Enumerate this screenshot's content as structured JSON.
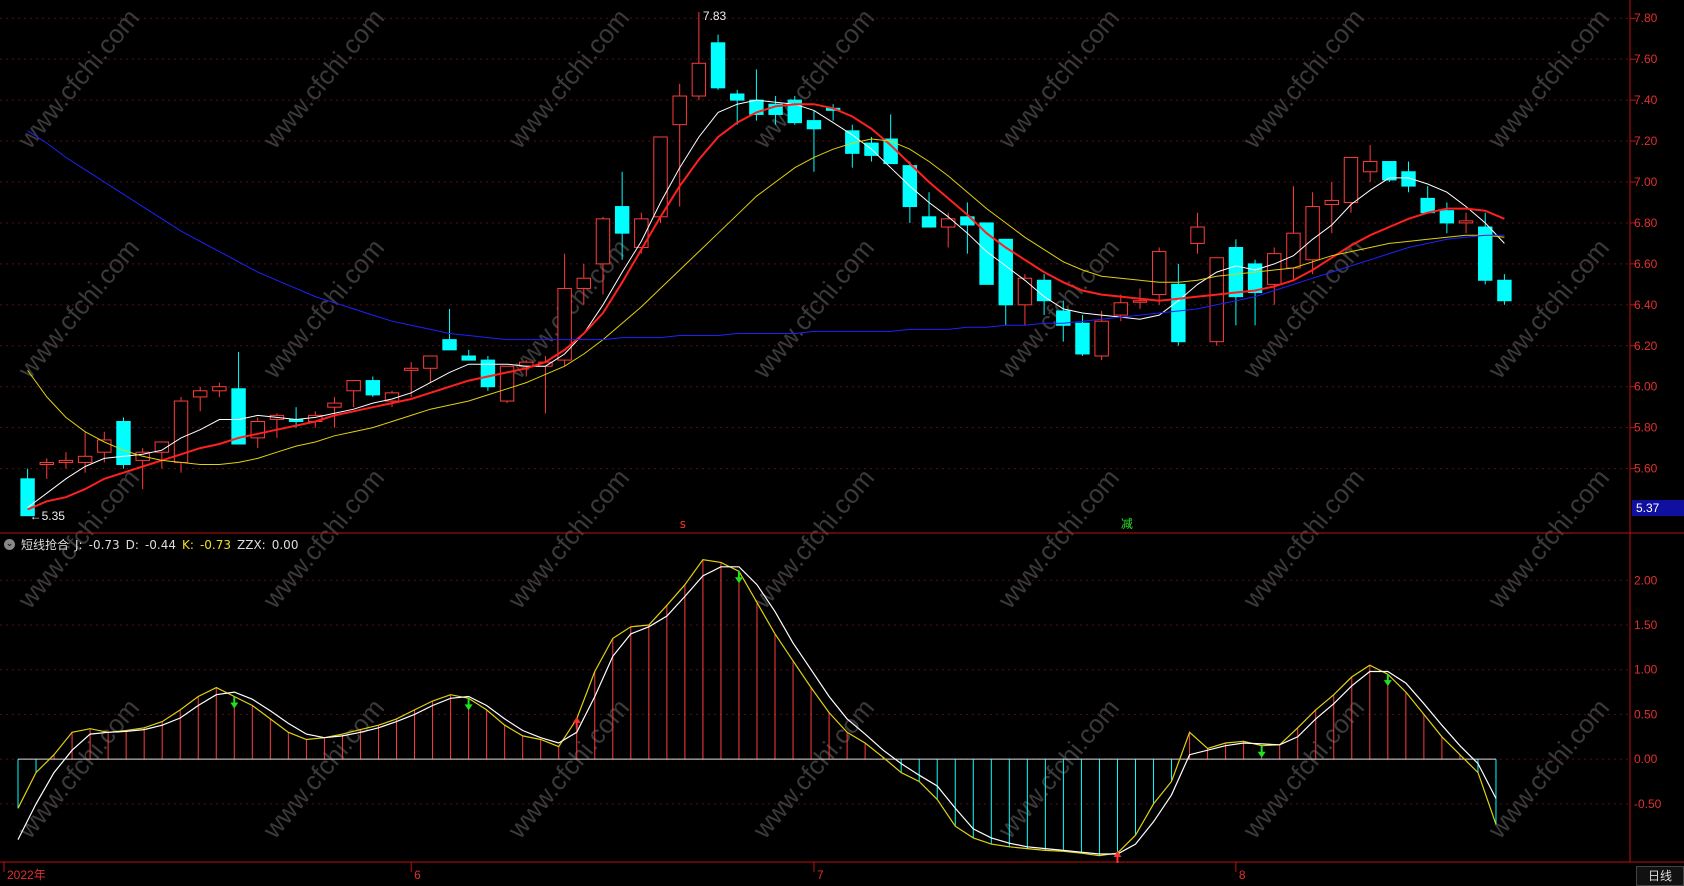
{
  "indicator": {
    "name": "短线抢合",
    "J_label": "J:",
    "J_value": "-0.73",
    "D_label": "D:",
    "D_value": "-0.44",
    "K_label": "K:",
    "K_value": "-0.73",
    "ZZX_label": "ZZX:",
    "ZZX_value": "0.00"
  },
  "timeframe_label": "日线",
  "price_axis": {
    "ticks": [
      "7.80",
      "7.60",
      "7.40",
      "7.20",
      "7.00",
      "6.80",
      "6.60",
      "6.40",
      "6.20",
      "6.00",
      "5.80",
      "5.60"
    ],
    "current_price": "5.37"
  },
  "indicator_axis": {
    "ticks": [
      "2.00",
      "1.50",
      "1.00",
      "0.50",
      "0.00",
      "-0.50"
    ]
  },
  "time_axis": {
    "labels": [
      "2022年",
      "6",
      "7",
      "8"
    ]
  },
  "markers": {
    "high_label": "7.83",
    "low_label": "5.35",
    "sell_glyph": "s",
    "reduce_glyph": "减"
  },
  "watermark": "www.cfchi.com",
  "colors": {
    "up": "#ff3b3b",
    "down": "#00ffff",
    "ma5": "#ffffff",
    "ma10": "#ff2020",
    "ma20": "#e0d010",
    "ma60": "#2020ff",
    "axis": "#c01010",
    "grid": "#551010"
  },
  "chart_data": [
    {
      "type": "candlestick",
      "title": "",
      "ylim": [
        5.3,
        7.85
      ],
      "grid": true,
      "candles": [
        {
          "o": 5.55,
          "h": 5.6,
          "l": 5.37,
          "c": 5.37
        },
        {
          "o": 5.62,
          "h": 5.65,
          "l": 5.55,
          "c": 5.63
        },
        {
          "o": 5.63,
          "h": 5.68,
          "l": 5.6,
          "c": 5.64
        },
        {
          "o": 5.63,
          "h": 5.78,
          "l": 5.58,
          "c": 5.66
        },
        {
          "o": 5.68,
          "h": 5.78,
          "l": 5.63,
          "c": 5.74
        },
        {
          "o": 5.83,
          "h": 5.85,
          "l": 5.6,
          "c": 5.62
        },
        {
          "o": 5.64,
          "h": 5.7,
          "l": 5.5,
          "c": 5.68
        },
        {
          "o": 5.68,
          "h": 5.73,
          "l": 5.6,
          "c": 5.73
        },
        {
          "o": 5.63,
          "h": 5.95,
          "l": 5.58,
          "c": 5.93
        },
        {
          "o": 5.95,
          "h": 6.0,
          "l": 5.88,
          "c": 5.98
        },
        {
          "o": 5.98,
          "h": 6.02,
          "l": 5.95,
          "c": 6.0
        },
        {
          "o": 5.99,
          "h": 6.17,
          "l": 5.72,
          "c": 5.72
        },
        {
          "o": 5.75,
          "h": 5.85,
          "l": 5.7,
          "c": 5.83
        },
        {
          "o": 5.84,
          "h": 5.87,
          "l": 5.75,
          "c": 5.86
        },
        {
          "o": 5.84,
          "h": 5.9,
          "l": 5.8,
          "c": 5.83
        },
        {
          "o": 5.83,
          "h": 5.88,
          "l": 5.8,
          "c": 5.86
        },
        {
          "o": 5.9,
          "h": 5.95,
          "l": 5.8,
          "c": 5.92
        },
        {
          "o": 5.98,
          "h": 6.03,
          "l": 5.9,
          "c": 6.03
        },
        {
          "o": 6.03,
          "h": 6.05,
          "l": 5.95,
          "c": 5.96
        },
        {
          "o": 5.93,
          "h": 5.98,
          "l": 5.9,
          "c": 5.97
        },
        {
          "o": 6.08,
          "h": 6.12,
          "l": 5.95,
          "c": 6.09
        },
        {
          "o": 6.09,
          "h": 6.15,
          "l": 6.02,
          "c": 6.15
        },
        {
          "o": 6.23,
          "h": 6.38,
          "l": 6.18,
          "c": 6.18
        },
        {
          "o": 6.15,
          "h": 6.18,
          "l": 6.13,
          "c": 6.13
        },
        {
          "o": 6.13,
          "h": 6.15,
          "l": 5.98,
          "c": 6.0
        },
        {
          "o": 5.93,
          "h": 6.1,
          "l": 5.92,
          "c": 6.1
        },
        {
          "o": 6.1,
          "h": 6.13,
          "l": 6.05,
          "c": 6.12
        },
        {
          "o": 6.1,
          "h": 6.15,
          "l": 5.87,
          "c": 6.12
        },
        {
          "o": 6.13,
          "h": 6.65,
          "l": 6.1,
          "c": 6.48
        },
        {
          "o": 6.48,
          "h": 6.6,
          "l": 6.4,
          "c": 6.53
        },
        {
          "o": 6.6,
          "h": 6.83,
          "l": 6.45,
          "c": 6.82
        },
        {
          "o": 6.88,
          "h": 7.05,
          "l": 6.62,
          "c": 6.75
        },
        {
          "o": 6.68,
          "h": 6.85,
          "l": 6.65,
          "c": 6.82
        },
        {
          "o": 6.83,
          "h": 7.2,
          "l": 6.8,
          "c": 7.22
        },
        {
          "o": 7.28,
          "h": 7.48,
          "l": 6.88,
          "c": 7.42
        },
        {
          "o": 7.42,
          "h": 7.83,
          "l": 7.4,
          "c": 7.58
        },
        {
          "o": 7.68,
          "h": 7.72,
          "l": 7.45,
          "c": 7.46
        },
        {
          "o": 7.43,
          "h": 7.45,
          "l": 7.28,
          "c": 7.4
        },
        {
          "o": 7.4,
          "h": 7.55,
          "l": 7.3,
          "c": 7.33
        },
        {
          "o": 7.38,
          "h": 7.42,
          "l": 7.28,
          "c": 7.33
        },
        {
          "o": 7.4,
          "h": 7.42,
          "l": 7.28,
          "c": 7.29
        },
        {
          "o": 7.3,
          "h": 7.35,
          "l": 7.05,
          "c": 7.26
        },
        {
          "o": 7.36,
          "h": 7.38,
          "l": 7.3,
          "c": 7.35
        },
        {
          "o": 7.25,
          "h": 7.28,
          "l": 7.07,
          "c": 7.14
        },
        {
          "o": 7.19,
          "h": 7.22,
          "l": 7.1,
          "c": 7.13
        },
        {
          "o": 7.21,
          "h": 7.33,
          "l": 7.09,
          "c": 7.09
        },
        {
          "o": 7.08,
          "h": 7.1,
          "l": 6.8,
          "c": 6.88
        },
        {
          "o": 6.83,
          "h": 6.95,
          "l": 6.78,
          "c": 6.78
        },
        {
          "o": 6.78,
          "h": 6.85,
          "l": 6.68,
          "c": 6.82
        },
        {
          "o": 6.83,
          "h": 6.9,
          "l": 6.65,
          "c": 6.79
        },
        {
          "o": 6.8,
          "h": 6.8,
          "l": 6.5,
          "c": 6.5
        },
        {
          "o": 6.72,
          "h": 6.72,
          "l": 6.3,
          "c": 6.4
        },
        {
          "o": 6.4,
          "h": 6.55,
          "l": 6.3,
          "c": 6.53
        },
        {
          "o": 6.52,
          "h": 6.55,
          "l": 6.35,
          "c": 6.42
        },
        {
          "o": 6.37,
          "h": 6.42,
          "l": 6.22,
          "c": 6.3
        },
        {
          "o": 6.31,
          "h": 6.35,
          "l": 6.15,
          "c": 6.16
        },
        {
          "o": 6.15,
          "h": 6.37,
          "l": 6.13,
          "c": 6.32
        },
        {
          "o": 6.35,
          "h": 6.45,
          "l": 6.32,
          "c": 6.41
        },
        {
          "o": 6.42,
          "h": 6.48,
          "l": 6.38,
          "c": 6.42
        },
        {
          "o": 6.45,
          "h": 6.68,
          "l": 6.4,
          "c": 6.66
        },
        {
          "o": 6.5,
          "h": 6.6,
          "l": 6.2,
          "c": 6.22
        },
        {
          "o": 6.7,
          "h": 6.85,
          "l": 6.65,
          "c": 6.78
        },
        {
          "o": 6.22,
          "h": 6.62,
          "l": 6.2,
          "c": 6.63
        },
        {
          "o": 6.68,
          "h": 6.72,
          "l": 6.3,
          "c": 6.44
        },
        {
          "o": 6.6,
          "h": 6.62,
          "l": 6.3,
          "c": 6.46
        },
        {
          "o": 6.5,
          "h": 6.68,
          "l": 6.4,
          "c": 6.65
        },
        {
          "o": 6.58,
          "h": 6.98,
          "l": 6.52,
          "c": 6.75
        },
        {
          "o": 6.62,
          "h": 6.95,
          "l": 6.55,
          "c": 6.88
        },
        {
          "o": 6.89,
          "h": 7.0,
          "l": 6.75,
          "c": 6.91
        },
        {
          "o": 6.9,
          "h": 7.1,
          "l": 6.85,
          "c": 7.12
        },
        {
          "o": 7.05,
          "h": 7.18,
          "l": 7.0,
          "c": 7.1
        },
        {
          "o": 7.1,
          "h": 7.05,
          "l": 7.0,
          "c": 7.01
        },
        {
          "o": 7.05,
          "h": 7.1,
          "l": 6.95,
          "c": 6.98
        },
        {
          "o": 6.92,
          "h": 6.98,
          "l": 6.85,
          "c": 6.85
        },
        {
          "o": 6.86,
          "h": 6.9,
          "l": 6.75,
          "c": 6.8
        },
        {
          "o": 6.8,
          "h": 6.85,
          "l": 6.75,
          "c": 6.81
        },
        {
          "o": 6.78,
          "h": 6.85,
          "l": 6.5,
          "c": 6.52
        },
        {
          "o": 6.52,
          "h": 6.55,
          "l": 6.4,
          "c": 6.42
        }
      ],
      "series": [
        {
          "name": "MA5",
          "values": [
            5.41,
            5.48,
            5.55,
            5.61,
            5.65,
            5.66,
            5.67,
            5.69,
            5.75,
            5.79,
            5.84,
            5.84,
            5.86,
            5.85,
            5.84,
            5.85,
            5.87,
            5.89,
            5.92,
            5.94,
            5.97,
            6.02,
            6.07,
            6.11,
            6.11,
            6.11,
            6.1,
            6.1,
            6.16,
            6.26,
            6.4,
            6.56,
            6.71,
            6.9,
            7.07,
            7.22,
            7.34,
            7.38,
            7.4,
            7.39,
            7.38,
            7.35,
            7.29,
            7.23,
            7.16,
            7.07,
            6.98,
            6.9,
            6.83,
            6.75,
            6.66,
            6.59,
            6.52,
            6.44,
            6.38,
            6.36,
            6.35,
            6.34,
            6.33,
            6.35,
            6.42,
            6.5,
            6.56,
            6.59,
            6.57,
            6.6,
            6.64,
            6.72,
            6.79,
            6.89,
            6.96,
            7.02,
            7.02,
            6.99,
            6.95,
            6.88,
            6.8,
            6.7
          ]
        },
        {
          "name": "MA10",
          "values": [
            5.4,
            5.44,
            5.46,
            5.5,
            5.55,
            5.58,
            5.61,
            5.64,
            5.67,
            5.7,
            5.72,
            5.75,
            5.77,
            5.79,
            5.81,
            5.83,
            5.86,
            5.88,
            5.9,
            5.92,
            5.94,
            5.97,
            6.0,
            6.03,
            6.05,
            6.07,
            6.09,
            6.12,
            6.18,
            6.26,
            6.36,
            6.51,
            6.67,
            6.83,
            6.98,
            7.11,
            7.22,
            7.29,
            7.34,
            7.37,
            7.38,
            7.38,
            7.36,
            7.32,
            7.26,
            7.18,
            7.09,
            7.0,
            6.92,
            6.84,
            6.75,
            6.68,
            6.62,
            6.56,
            6.51,
            6.47,
            6.45,
            6.44,
            6.43,
            6.42,
            6.43,
            6.44,
            6.45,
            6.46,
            6.47,
            6.49,
            6.52,
            6.57,
            6.63,
            6.69,
            6.74,
            6.78,
            6.82,
            6.85,
            6.87,
            6.87,
            6.86,
            6.82
          ]
        },
        {
          "name": "MA20",
          "values": [
            6.08,
            5.95,
            5.85,
            5.78,
            5.73,
            5.69,
            5.66,
            5.64,
            5.63,
            5.62,
            5.62,
            5.63,
            5.65,
            5.68,
            5.71,
            5.73,
            5.76,
            5.78,
            5.8,
            5.83,
            5.86,
            5.89,
            5.91,
            5.93,
            5.96,
            5.99,
            6.02,
            6.06,
            6.1,
            6.16,
            6.23,
            6.31,
            6.39,
            6.48,
            6.57,
            6.66,
            6.75,
            6.84,
            6.93,
            7.0,
            7.07,
            7.12,
            7.16,
            7.19,
            7.21,
            7.2,
            7.16,
            7.1,
            7.03,
            6.95,
            6.87,
            6.8,
            6.73,
            6.67,
            6.61,
            6.57,
            6.54,
            6.53,
            6.52,
            6.51,
            6.51,
            6.52,
            6.54,
            6.55,
            6.56,
            6.57,
            6.58,
            6.61,
            6.64,
            6.66,
            6.68,
            6.7,
            6.71,
            6.72,
            6.73,
            6.74,
            6.74,
            6.73
          ]
        },
        {
          "name": "MA60",
          "values": [
            7.25,
            7.19,
            7.12,
            7.06,
            7.0,
            6.94,
            6.88,
            6.82,
            6.76,
            6.71,
            6.66,
            6.61,
            6.56,
            6.52,
            6.48,
            6.44,
            6.41,
            6.38,
            6.35,
            6.32,
            6.3,
            6.28,
            6.26,
            6.25,
            6.24,
            6.23,
            6.23,
            6.23,
            6.23,
            6.23,
            6.23,
            6.24,
            6.24,
            6.24,
            6.25,
            6.25,
            6.25,
            6.26,
            6.26,
            6.26,
            6.26,
            6.27,
            6.27,
            6.27,
            6.27,
            6.27,
            6.28,
            6.28,
            6.28,
            6.29,
            6.29,
            6.3,
            6.3,
            6.31,
            6.31,
            6.32,
            6.33,
            6.34,
            6.35,
            6.36,
            6.37,
            6.38,
            6.4,
            6.42,
            6.44,
            6.47,
            6.5,
            6.53,
            6.56,
            6.59,
            6.62,
            6.65,
            6.68,
            6.7,
            6.72,
            6.73,
            6.74,
            6.74
          ]
        }
      ]
    },
    {
      "type": "bar",
      "title": "短线抢合",
      "ylim": [
        -1.15,
        2.45
      ],
      "grid": true,
      "values": [
        -0.55,
        -0.15,
        0.05,
        0.3,
        0.34,
        0.3,
        0.32,
        0.35,
        0.42,
        0.55,
        0.7,
        0.8,
        0.7,
        0.6,
        0.45,
        0.3,
        0.22,
        0.24,
        0.28,
        0.33,
        0.38,
        0.45,
        0.55,
        0.65,
        0.72,
        0.68,
        0.55,
        0.38,
        0.26,
        0.22,
        0.14,
        0.45,
        0.98,
        1.35,
        1.48,
        1.5,
        1.72,
        1.95,
        2.23,
        2.2,
        2.1,
        1.75,
        1.4,
        1.1,
        0.8,
        0.52,
        0.3,
        0.18,
        0.02,
        -0.15,
        -0.25,
        -0.45,
        -0.75,
        -0.88,
        -0.95,
        -0.98,
        -1.0,
        -1.02,
        -1.03,
        -1.05,
        -1.08,
        -1.05,
        -0.85,
        -0.5,
        -0.25,
        0.3,
        0.12,
        0.18,
        0.2,
        0.15,
        0.16,
        0.35,
        0.55,
        0.72,
        0.92,
        1.05,
        0.95,
        0.75,
        0.5,
        0.25,
        0.05,
        -0.15,
        -0.73
      ],
      "J": [
        -0.55,
        -0.15,
        0.05,
        0.3,
        0.34,
        0.3,
        0.32,
        0.35,
        0.42,
        0.55,
        0.7,
        0.8,
        0.7,
        0.6,
        0.45,
        0.3,
        0.22,
        0.24,
        0.28,
        0.33,
        0.38,
        0.45,
        0.55,
        0.65,
        0.72,
        0.68,
        0.55,
        0.38,
        0.26,
        0.22,
        0.14,
        0.45,
        0.98,
        1.35,
        1.48,
        1.5,
        1.72,
        1.95,
        2.23,
        2.2,
        2.1,
        1.75,
        1.4,
        1.1,
        0.8,
        0.52,
        0.3,
        0.18,
        0.02,
        -0.15,
        -0.25,
        -0.45,
        -0.75,
        -0.88,
        -0.95,
        -0.98,
        -1.0,
        -1.02,
        -1.03,
        -1.05,
        -1.08,
        -1.05,
        -0.85,
        -0.5,
        -0.25,
        0.3,
        0.12,
        0.18,
        0.2,
        0.15,
        0.16,
        0.35,
        0.55,
        0.72,
        0.92,
        1.05,
        0.95,
        0.75,
        0.5,
        0.25,
        0.05,
        -0.15,
        -0.73
      ],
      "D": [
        -0.9,
        -0.5,
        -0.15,
        0.1,
        0.28,
        0.3,
        0.31,
        0.33,
        0.38,
        0.46,
        0.6,
        0.72,
        0.75,
        0.67,
        0.54,
        0.4,
        0.28,
        0.24,
        0.26,
        0.3,
        0.35,
        0.42,
        0.5,
        0.6,
        0.68,
        0.7,
        0.6,
        0.45,
        0.32,
        0.24,
        0.18,
        0.3,
        0.7,
        1.15,
        1.4,
        1.48,
        1.6,
        1.82,
        2.05,
        2.15,
        2.15,
        1.95,
        1.65,
        1.3,
        1.0,
        0.7,
        0.45,
        0.28,
        0.1,
        -0.05,
        -0.18,
        -0.3,
        -0.55,
        -0.78,
        -0.88,
        -0.94,
        -0.98,
        -1.0,
        -1.02,
        -1.04,
        -1.06,
        -1.06,
        -0.95,
        -0.7,
        -0.4,
        0.05,
        0.1,
        0.15,
        0.18,
        0.17,
        0.16,
        0.25,
        0.45,
        0.62,
        0.82,
        0.98,
        0.98,
        0.85,
        0.62,
        0.38,
        0.15,
        -0.05,
        -0.44
      ]
    }
  ]
}
